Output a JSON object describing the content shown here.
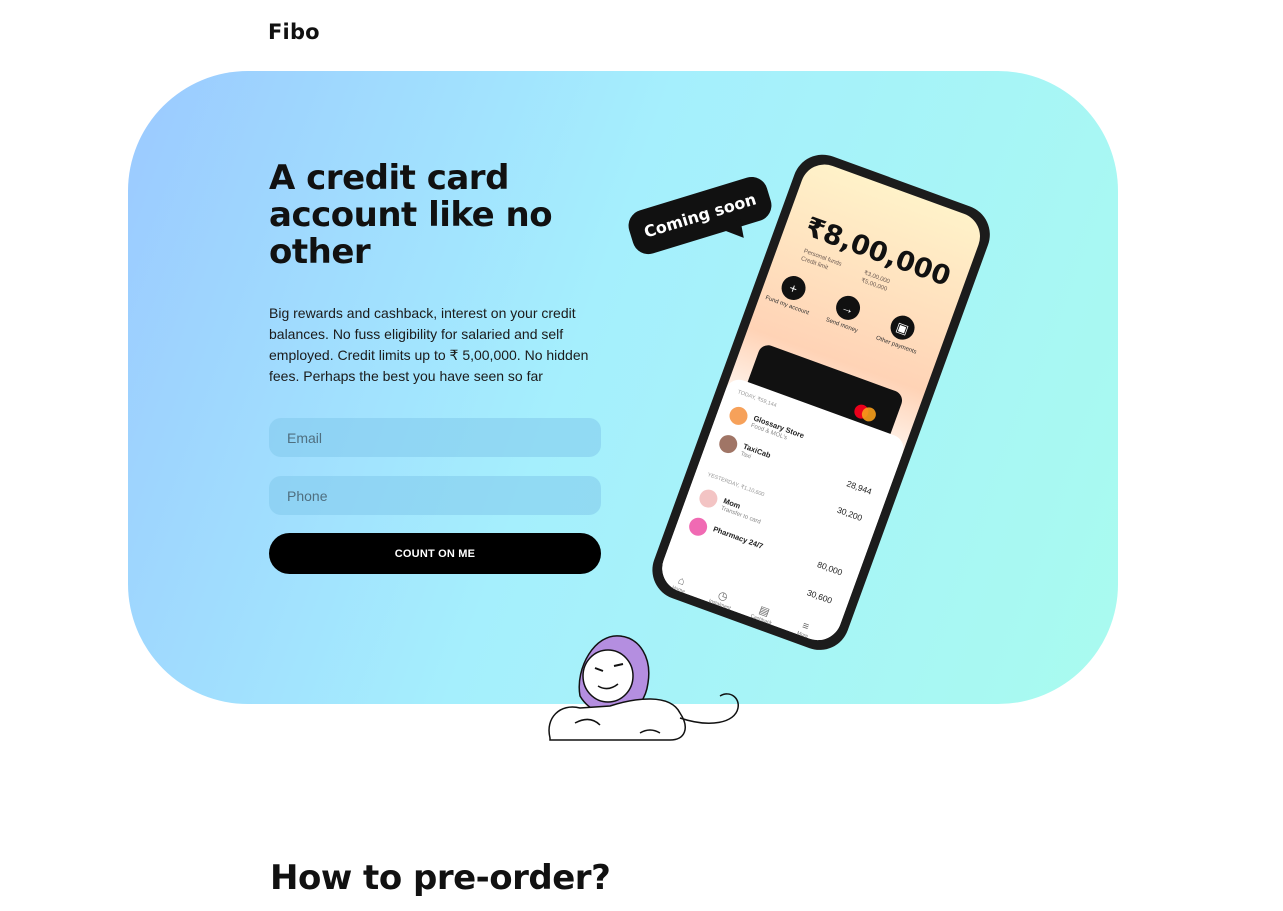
{
  "brand": {
    "logo": "Fibo"
  },
  "hero": {
    "headline": "A credit card account like no other",
    "description": "Big rewards and cashback, interest on your credit balances. No fuss eligibility for salaried and self employed. Credit limits up to  ₹ 5,00,000. No hidden fees. Perhaps the best you have seen so far",
    "email_placeholder": "Email",
    "phone_placeholder": "Phone",
    "cta_label": "COUNT ON ME",
    "badge": "Coming soon",
    "colors": {
      "gradient_start": "#9bc9ff",
      "gradient_end": "#a9fbef",
      "cta": "#000000"
    }
  },
  "phone_mockup": {
    "balance": "₹8,00,000",
    "personal_funds_label": "Personal funds",
    "credit_limit_label": "Credit limit",
    "personal_funds_value": "₹3,00,000",
    "credit_limit_value": "₹5,00,000",
    "actions": [
      {
        "icon": "plus-icon",
        "label": "Fund my account"
      },
      {
        "icon": "arrow-right-icon",
        "label": "Send money"
      },
      {
        "icon": "wallet-icon",
        "label": "Other payments"
      }
    ],
    "today_label": "TODAY, ₹59,144",
    "yesterday_label": "YESTERDAY, ₹1,10,600",
    "transactions": [
      {
        "name": "Glossary Store",
        "category": "Food & MOL's",
        "amount": "28,944"
      },
      {
        "name": "TaxiCab",
        "category": "Taxi",
        "amount": "30,200"
      },
      {
        "name": "Mom",
        "category": "Transfer to card",
        "amount": "80,000"
      },
      {
        "name": "Pharmacy 24/7",
        "category": "",
        "amount": "30,600"
      }
    ],
    "nav": [
      "Home",
      "Instalment",
      "Cashback",
      "More"
    ]
  },
  "section": {
    "title": "How to pre-order?"
  }
}
